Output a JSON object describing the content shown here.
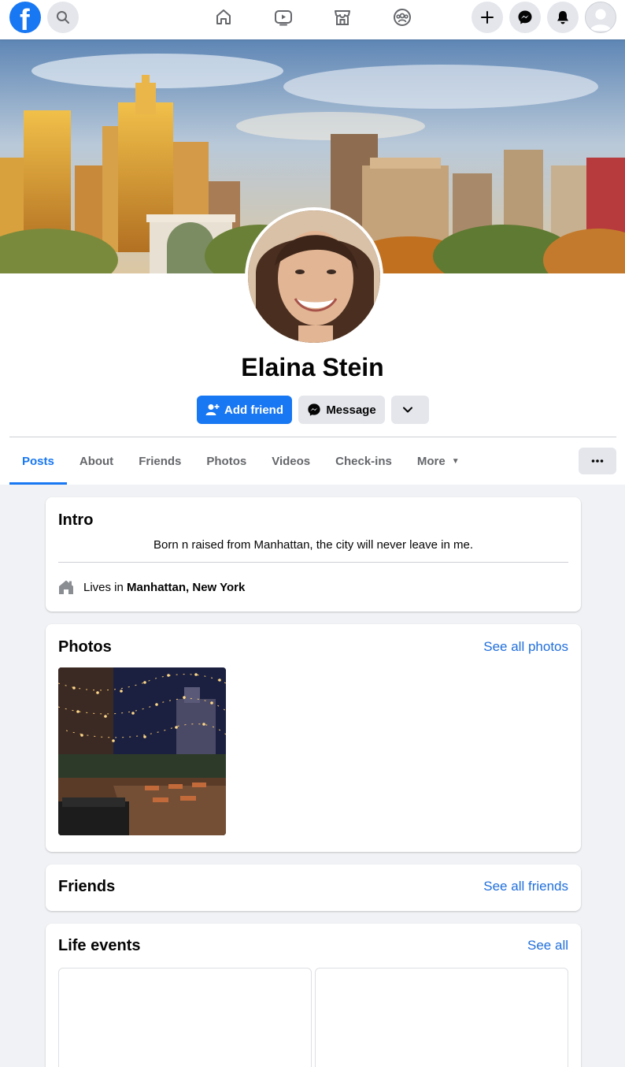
{
  "nav": {
    "logo_letter": "f",
    "center_icons": [
      "home-icon",
      "watch-icon",
      "marketplace-icon",
      "groups-icon"
    ],
    "right_icons": [
      "plus-icon",
      "messenger-icon",
      "bell-icon"
    ]
  },
  "profile": {
    "name": "Elaina Stein",
    "add_friend_label": "Add friend",
    "message_label": "Message"
  },
  "tabs": [
    {
      "label": "Posts",
      "active": true
    },
    {
      "label": "About"
    },
    {
      "label": "Friends"
    },
    {
      "label": "Photos"
    },
    {
      "label": "Videos"
    },
    {
      "label": "Check-ins"
    },
    {
      "label": "More"
    }
  ],
  "intro": {
    "title": "Intro",
    "bio": "Born n raised from Manhattan, the city will never leave in me.",
    "lives_prefix": "Lives in ",
    "lives_place": "Manhattan, New York"
  },
  "photos": {
    "title": "Photos",
    "see_all": "See all photos"
  },
  "friends": {
    "title": "Friends",
    "see_all": "See all friends"
  },
  "life_events": {
    "title": "Life events",
    "see_all": "See all"
  },
  "colors": {
    "brand": "#1877f2",
    "link": "#216fdb",
    "background": "#f0f2f5"
  }
}
